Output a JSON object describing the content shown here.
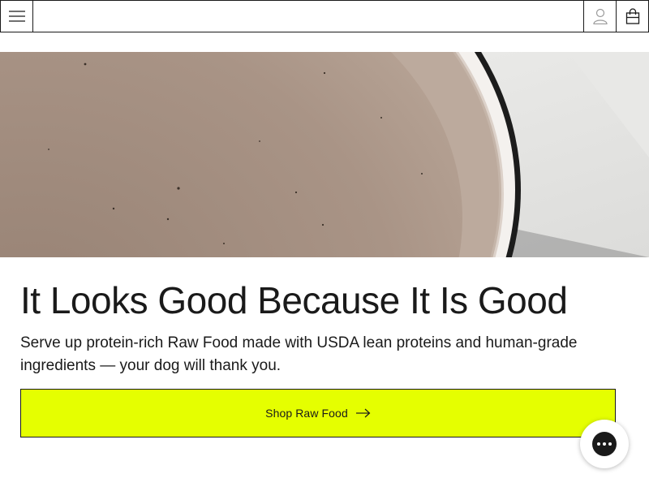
{
  "header": {
    "menu_icon": "hamburger-menu-icon",
    "account_icon": "user-account-icon",
    "cart_icon": "shopping-bag-icon"
  },
  "hero": {
    "image": "food-bowl-photo"
  },
  "content": {
    "headline": "It Looks Good Because It Is Good",
    "subtext": "Serve up protein-rich Raw Food made with USDA lean proteins and human-grade ingredients — your dog will thank you.",
    "cta_label": "Shop Raw Food",
    "cta_icon": "arrow-right-icon"
  },
  "chat": {
    "icon": "chat-bubble-icon"
  },
  "colors": {
    "cta_background": "#e5ff00",
    "border": "#1a1a1a",
    "text": "#1a1a1a"
  }
}
